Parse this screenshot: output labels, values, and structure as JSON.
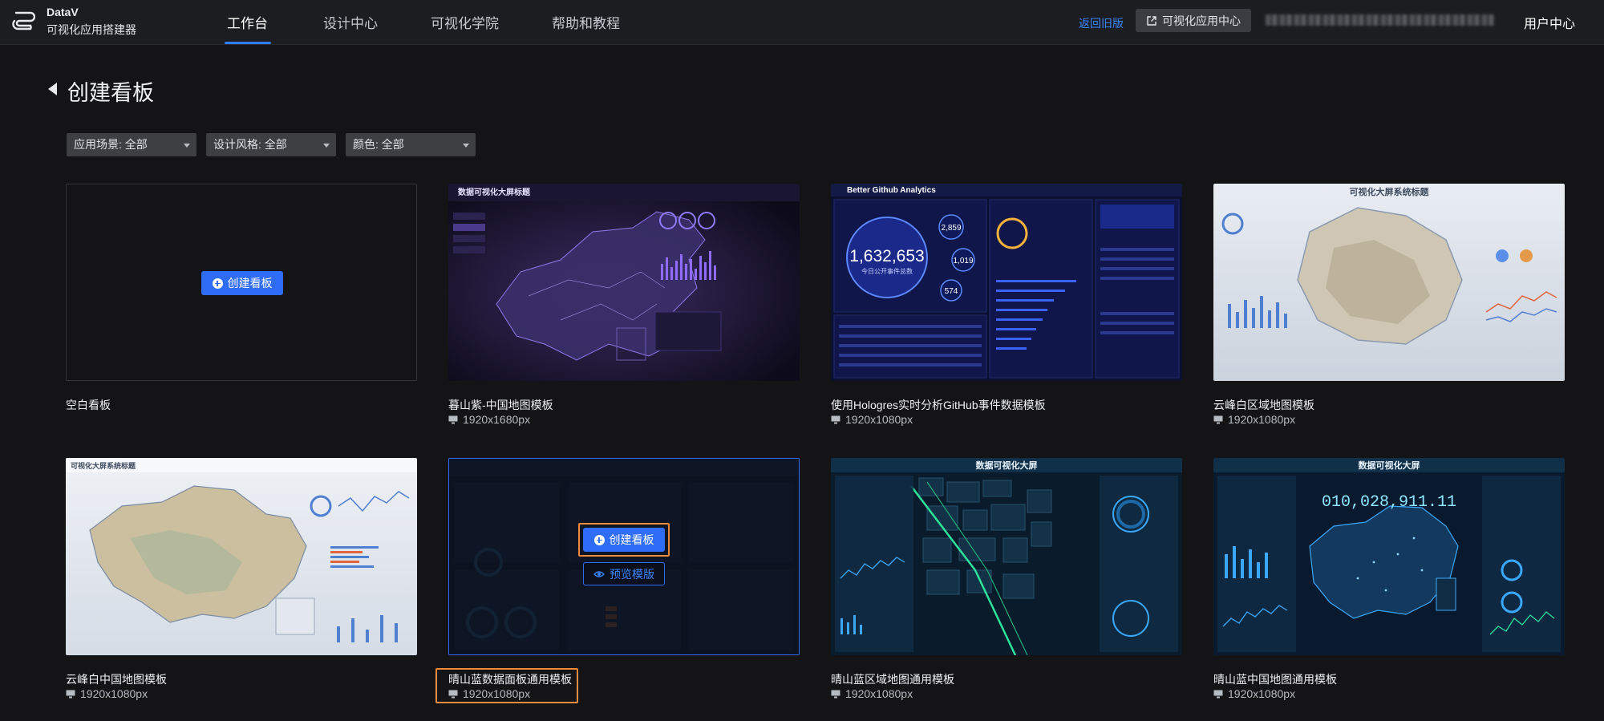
{
  "brand": {
    "name": "DataV",
    "subtitle": "可视化应用搭建器"
  },
  "nav": {
    "items": [
      {
        "label": "工作台",
        "active": true
      },
      {
        "label": "设计中心",
        "active": false
      },
      {
        "label": "可视化学院",
        "active": false
      },
      {
        "label": "帮助和教程",
        "active": false
      }
    ],
    "return_old": "返回旧版",
    "app_center": "可视化应用中心",
    "user_center": "用户中心"
  },
  "page": {
    "title": "创建看板"
  },
  "filters": [
    {
      "label": "应用场景:",
      "value": "全部"
    },
    {
      "label": "设计风格:",
      "value": "全部"
    },
    {
      "label": "颜色:",
      "value": "全部"
    }
  ],
  "actions": {
    "create": "创建看板",
    "preview": "预览模版"
  },
  "templates": [
    {
      "title": "空白看板",
      "resolution": ""
    },
    {
      "title": "暮山紫-中国地图模板",
      "resolution": "1920x1680px"
    },
    {
      "title": "使用Hologres实时分析GitHub事件数据模板",
      "resolution": "1920x1080px"
    },
    {
      "title": "云峰白区域地图模板",
      "resolution": "1920x1080px"
    },
    {
      "title": "云峰白中国地图模板",
      "resolution": "1920x1080px"
    },
    {
      "title": "晴山蓝数据面板通用模板",
      "resolution": "1920x1080px"
    },
    {
      "title": "晴山蓝区域地图通用模板",
      "resolution": "1920x1080px"
    },
    {
      "title": "晴山蓝中国地图通用模板",
      "resolution": "1920x1080px"
    }
  ],
  "thumbnail_text": {
    "purple_title": "数据可视化大屏标题",
    "github_title": "Better Github Analytics",
    "github_total": "1,632,653",
    "github_total_label": "今日公开事件总数",
    "github_b1": "2,859",
    "github_b2": "1,019",
    "github_b3": "574",
    "white_region_title": "可视化大屏系统标题",
    "white_china_title": "可视化大屏系统标题",
    "blue_region_title": "数据可视化大屏",
    "blue_china_title": "数据可视化大屏",
    "blue_china_number": "010,028,911.11"
  }
}
